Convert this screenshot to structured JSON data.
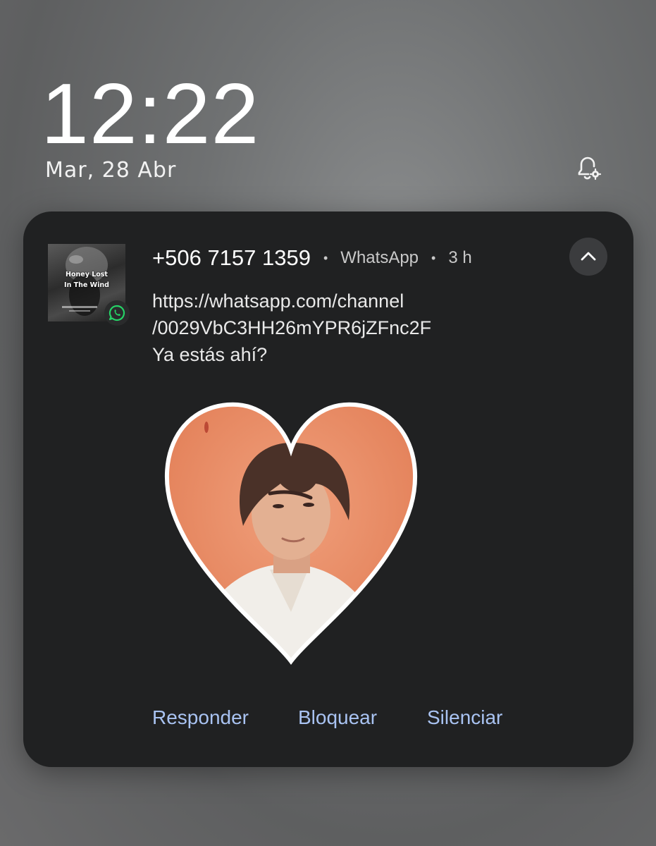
{
  "lockscreen": {
    "time": "12:22",
    "date": "Mar, 28 Abr",
    "notification_settings_icon": "bell-gear-icon"
  },
  "notification": {
    "avatar": {
      "title_line1": "Honey Lost",
      "title_line2": "In The Wind"
    },
    "app_icon": "whatsapp-icon",
    "sender": "+506 7157 1359",
    "separator": "•",
    "app_name": "WhatsApp",
    "time_ago": "3 h",
    "collapse_icon": "chevron-up-icon",
    "message_lines": [
      "https://whatsapp.com/channel",
      "/0029VbC3HH26mYPR6jZFnc2F",
      "Ya estás ahí?"
    ],
    "sticker": "heart-photo-sticker",
    "actions": [
      {
        "label": "Responder"
      },
      {
        "label": "Bloquear"
      },
      {
        "label": "Silenciar"
      }
    ]
  },
  "colors": {
    "card_background": "#202122",
    "action_text": "#a9c3f2",
    "whatsapp_green": "#25d366",
    "sticker_orange": "#e98c66"
  }
}
